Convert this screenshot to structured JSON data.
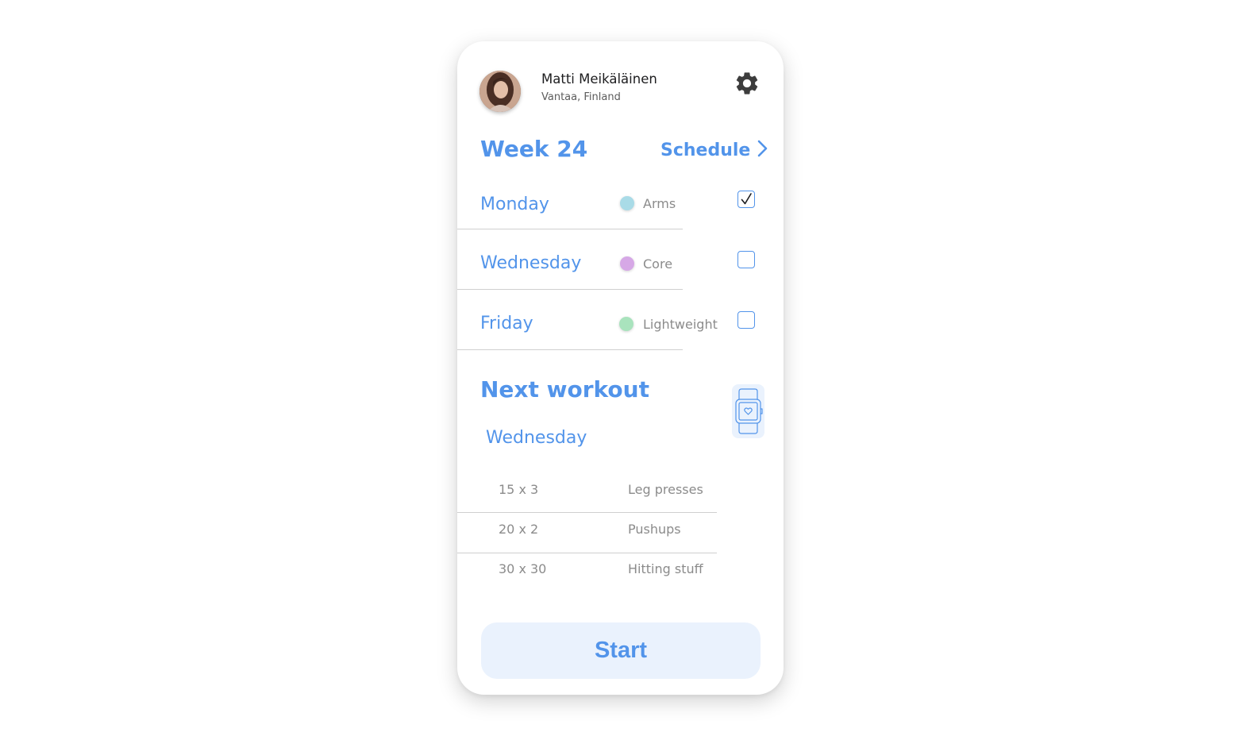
{
  "user": {
    "name": "Matti Meikäläinen",
    "location": "Vantaa, Finland"
  },
  "week": {
    "title": "Week 24",
    "schedule_label": "Schedule"
  },
  "days": [
    {
      "day": "Monday",
      "type": "Arms",
      "dot_color": "#a9dbe7",
      "checked": true
    },
    {
      "day": "Wednesday",
      "type": "Core",
      "dot_color": "#d6a8e6",
      "checked": false
    },
    {
      "day": "Friday",
      "type": "Lightweight",
      "dot_color": "#a9e3bd",
      "checked": false
    }
  ],
  "next_workout": {
    "title": "Next workout",
    "day": "Wednesday",
    "exercises": [
      {
        "reps": "15 x 3",
        "name": "Leg presses"
      },
      {
        "reps": "20 x 2",
        "name": "Pushups"
      },
      {
        "reps": "30 x 30",
        "name": "Hitting stuff"
      }
    ]
  },
  "start_label": "Start",
  "colors": {
    "accent": "#5294ea",
    "button_bg": "#eaf2fd",
    "muted_text": "#8b8b8b"
  },
  "icons": {
    "settings": "gear-icon",
    "schedule_arrow": "chevron-right-icon",
    "watch": "smartwatch-heart-icon",
    "checkmark": "check-icon"
  }
}
